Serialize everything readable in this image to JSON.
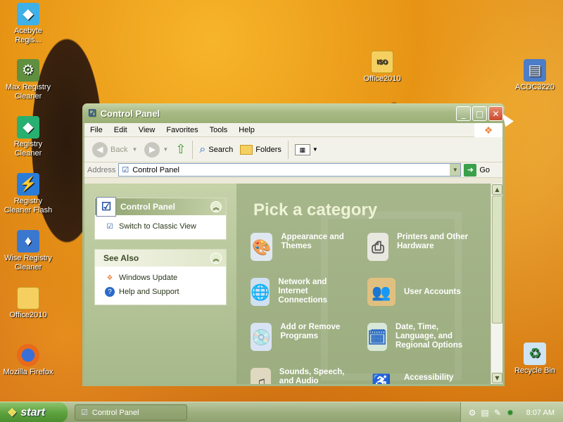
{
  "desktop_icons": [
    {
      "name": "acebyte-icon",
      "label": "Acebyte Regis...",
      "glyph": "◆",
      "color": "#3fb0e8"
    },
    {
      "name": "max-registry-icon",
      "label": "Max Registry Cleaner",
      "glyph": "⚙",
      "color": "#5f8f3f"
    },
    {
      "name": "registry-cleaner-icon",
      "label": "Registry Cleaner",
      "glyph": "◆",
      "color": "#28b070"
    },
    {
      "name": "registry-cleaner-flash-icon",
      "label": "Registry Cleaner Flash",
      "glyph": "⚡",
      "color": "#2a7cd8"
    },
    {
      "name": "wise-registry-icon",
      "label": "Wise Registry Cleaner",
      "glyph": "♦",
      "color": "#3a78d0"
    },
    {
      "name": "office2010-left-icon",
      "label": "Office2010",
      "glyph": "",
      "color": "#f5d060"
    },
    {
      "name": "firefox-icon",
      "label": "Mozilla Firefox",
      "glyph": "●",
      "color": "#e86a1a"
    },
    {
      "name": "office2010-folder-icon",
      "label": "Office2010",
      "glyph": "ISO",
      "color": "#f5d060"
    },
    {
      "name": "acdc-icon",
      "label": "ACDC3220",
      "glyph": "▤",
      "color": "#4c7dc8"
    },
    {
      "name": "recycle-bin-icon",
      "label": "Recycle Bin",
      "glyph": "♻",
      "color": "#58a0d8"
    }
  ],
  "window": {
    "title": "Control Panel"
  },
  "menu": [
    "File",
    "Edit",
    "View",
    "Favorites",
    "Tools",
    "Help"
  ],
  "toolbar": {
    "back": "Back",
    "search": "Search",
    "folders": "Folders"
  },
  "address": {
    "label": "Address",
    "value": "Control Panel",
    "go": "Go"
  },
  "left_pane": {
    "control_panel_title": "Control Panel",
    "switch_view": "Switch to Classic View",
    "see_also_title": "See Also",
    "windows_update": "Windows Update",
    "help_support": "Help and Support"
  },
  "main": {
    "heading": "Pick a category",
    "categories": [
      {
        "label": "Appearance and Themes"
      },
      {
        "label": "Printers and Other Hardware"
      },
      {
        "label": "Network and Internet Connections"
      },
      {
        "label": "User Accounts"
      },
      {
        "label": "Add or Remove Programs"
      },
      {
        "label": "Date, Time, Language, and Regional Options"
      },
      {
        "label": "Sounds, Speech, and Audio"
      },
      {
        "label": "Accessibility"
      }
    ]
  },
  "taskbar": {
    "start": "start",
    "task": "Control Panel",
    "clock": "8:07 AM"
  }
}
